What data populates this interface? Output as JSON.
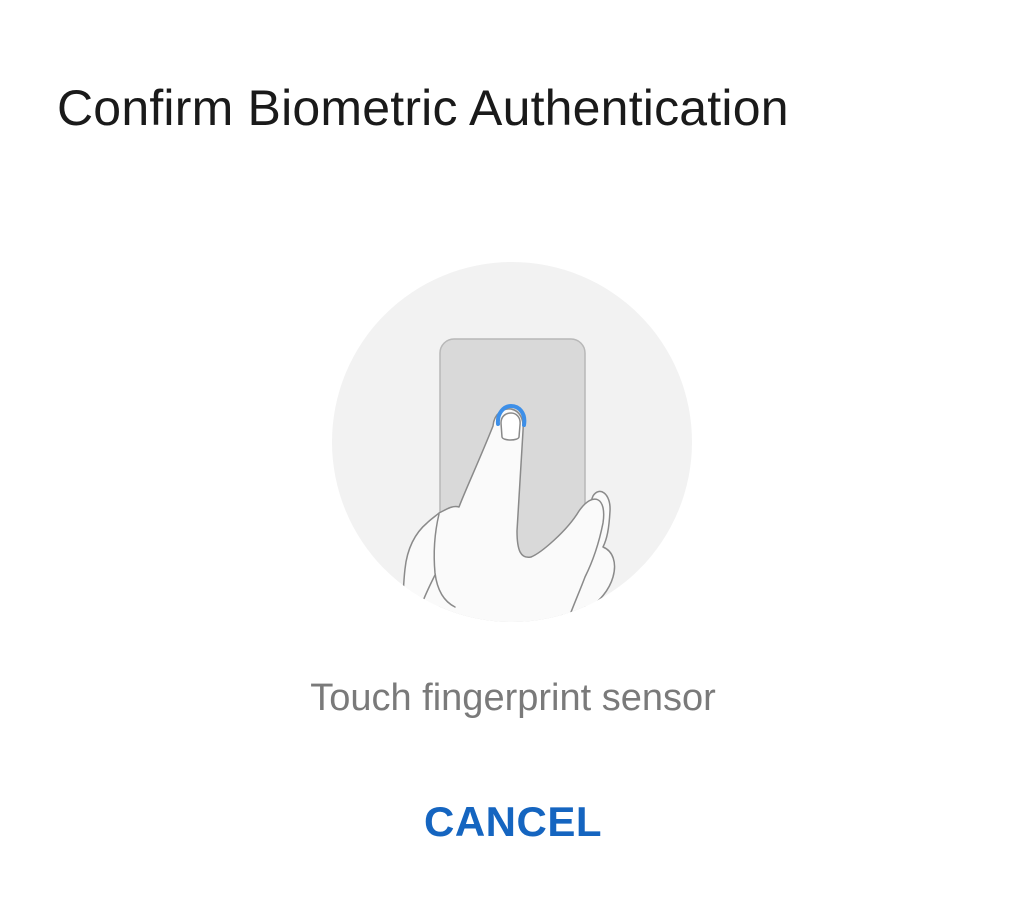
{
  "dialog": {
    "title": "Confirm Biometric Authentication",
    "prompt": "Touch fingerprint sensor",
    "cancel_label": "CANCEL"
  },
  "illustration": {
    "icon": "fingerprint-touch-icon",
    "accent_color": "#3d8fe8",
    "circle_color": "#f2f2f2",
    "device_color": "#d9d9d9"
  },
  "colors": {
    "title": "#1a1a1a",
    "prompt": "#7a7a7a",
    "button": "#1565c0",
    "background": "#ffffff"
  }
}
